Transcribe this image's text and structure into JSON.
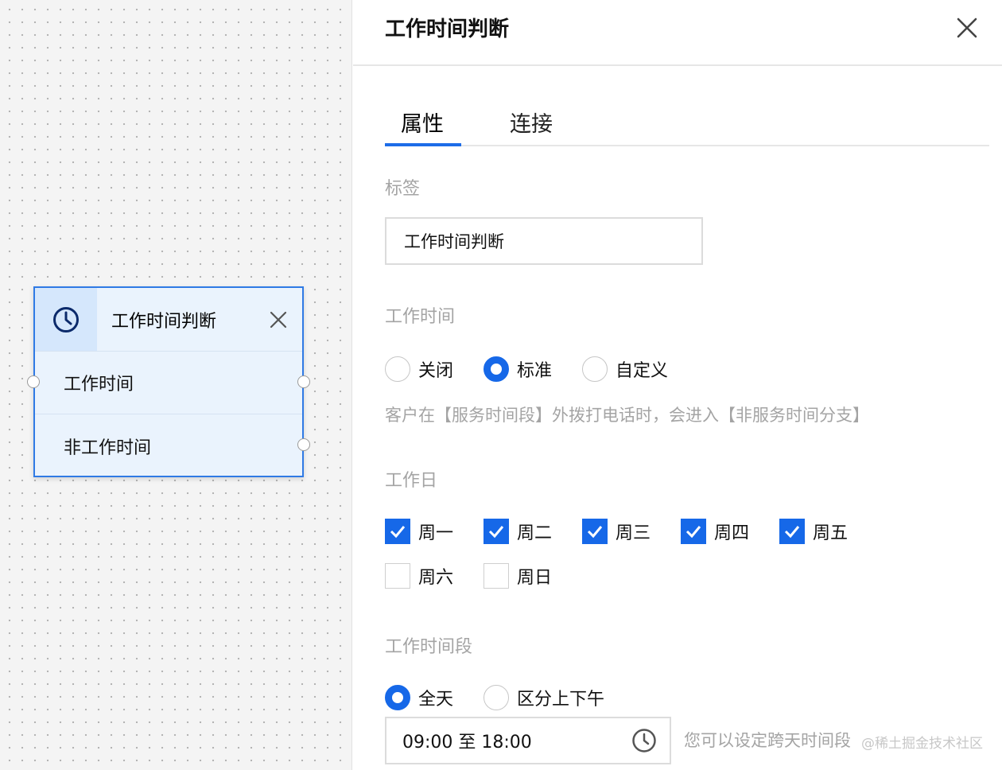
{
  "node": {
    "title": "工作时间判断",
    "branches": [
      "工作时间",
      "非工作时间"
    ]
  },
  "panel": {
    "title": "工作时间判断",
    "tabs": [
      {
        "label": "属性",
        "active": true
      },
      {
        "label": "连接",
        "active": false
      }
    ]
  },
  "label_section": {
    "heading": "标签",
    "value": "工作时间判断"
  },
  "work_time": {
    "heading": "工作时间",
    "options": [
      {
        "label": "关闭",
        "selected": false
      },
      {
        "label": "标准",
        "selected": true
      },
      {
        "label": "自定义",
        "selected": false
      }
    ],
    "hint": "客户在【服务时间段】外拨打电话时，会进入【非服务时间分支】"
  },
  "workdays": {
    "heading": "工作日",
    "days": [
      {
        "label": "周一",
        "checked": true
      },
      {
        "label": "周二",
        "checked": true
      },
      {
        "label": "周三",
        "checked": true
      },
      {
        "label": "周四",
        "checked": true
      },
      {
        "label": "周五",
        "checked": true
      },
      {
        "label": "周六",
        "checked": false
      },
      {
        "label": "周日",
        "checked": false
      }
    ]
  },
  "work_period": {
    "heading": "工作时间段",
    "options": [
      {
        "label": "全天",
        "selected": true
      },
      {
        "label": "区分上下午",
        "selected": false
      }
    ],
    "time_range": "09:00 至 18:00",
    "hint": "您可以设定跨天时间段"
  },
  "watermark": "@稀土掘金技术社区",
  "colors": {
    "accent": "#1668e8",
    "node_border": "#2f7ae5",
    "node_bg": "#eaf3fd",
    "muted_text": "#a4a4a4"
  },
  "icons": {
    "node_icon": "clock-icon",
    "close": "close-icon",
    "time_picker": "clock-icon",
    "checkbox_mark": "checkmark-icon"
  }
}
